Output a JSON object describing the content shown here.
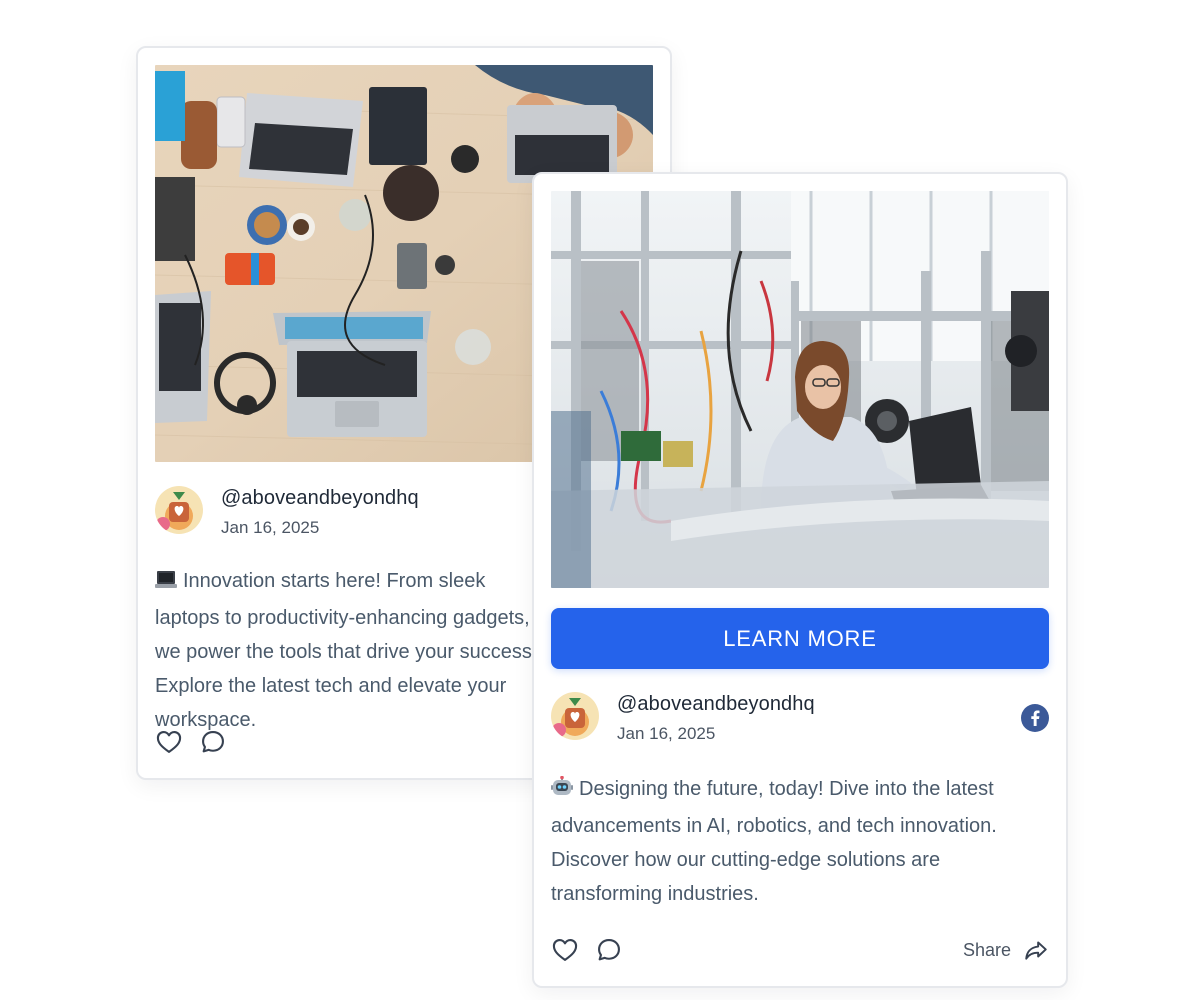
{
  "cards": [
    {
      "id": "laptop-post",
      "author": {
        "handle": "@aboveandbeyondhq",
        "date": "Jan 16, 2025"
      },
      "post_text": "Innovation starts here! From sleek laptops to productivity-enhancing gadgets, we power the tools that drive your success. Explore the latest tech and elevate your workspace.",
      "emoji_icon": "laptop-icon"
    },
    {
      "id": "robotics-post",
      "cta_label": "LEARN MORE",
      "author": {
        "handle": "@aboveandbeyondhq",
        "date": "Jan 16, 2025"
      },
      "post_text": "Designing the future, today! Dive into the latest advancements in AI, robotics, and tech innovation. Discover how our cutting-edge solutions are transforming industries.",
      "emoji_icon": "robot-icon",
      "share_label": "Share",
      "source_icon": "facebook-icon"
    }
  ],
  "colors": {
    "accent": "#2563eb",
    "facebook": "#3b5998",
    "text": "#4a5a6b",
    "border": "#e6e8ec"
  }
}
